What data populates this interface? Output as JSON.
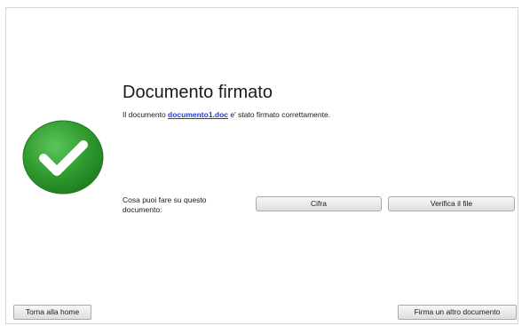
{
  "result": {
    "title": "Documento firmato",
    "message_prefix": "Il documento ",
    "file_link": "documento1.doc",
    "message_suffix": " e' stato firmato correttamente."
  },
  "actions": {
    "question": "Cosa puoi fare su questo documento:",
    "encrypt_label": "Cifra",
    "verify_label": "Verifica il file"
  },
  "footer": {
    "home_label": "Torna alla home",
    "sign_another_label": "Firma un altro documento"
  },
  "colors": {
    "success": "#2e9a2e",
    "link": "#1f3fd6"
  },
  "icons": {
    "status": "check-circle-icon"
  }
}
